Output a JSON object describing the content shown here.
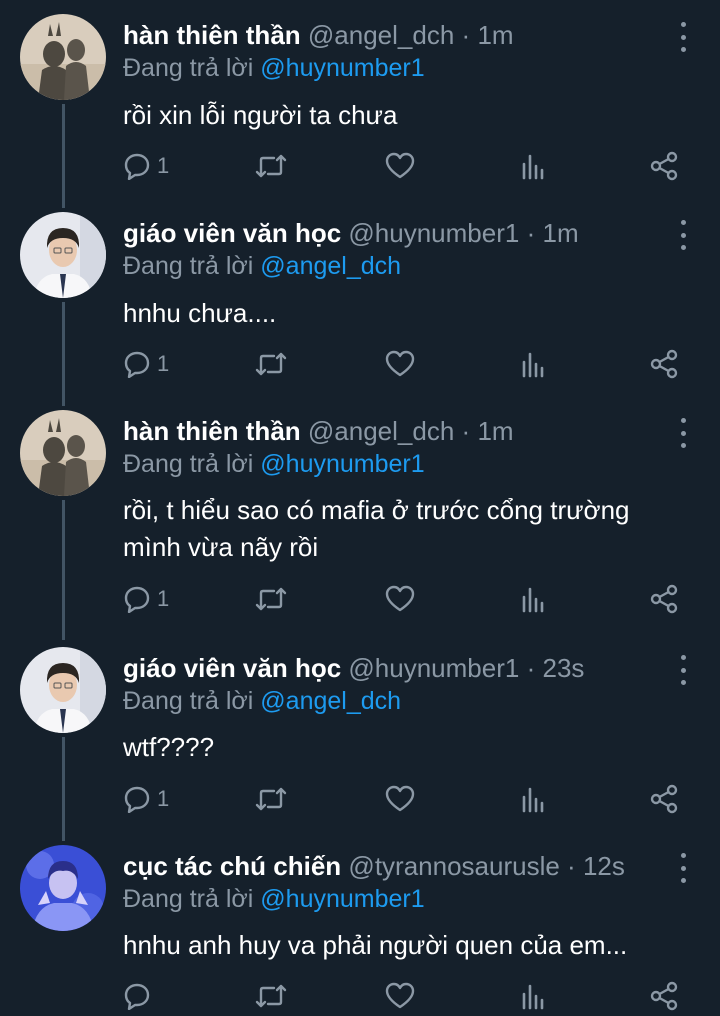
{
  "tweets": [
    {
      "name": "hàn thiên thần",
      "handle": "@angel_dch",
      "dot": "·",
      "time": "1m",
      "reply_prefix": "Đang trả lời",
      "reply_mention": "@huynumber1",
      "lines": [
        "rồi xin lỗi người ta chưa"
      ],
      "reply_count": "1",
      "avatar": "shadow-selfie-avatar"
    },
    {
      "name": "giáo viên văn học",
      "handle": "@huynumber1",
      "dot": "·",
      "time": "1m",
      "reply_prefix": "Đang trả lời",
      "reply_mention": "@angel_dch",
      "lines": [
        "hnhu chưa...."
      ],
      "reply_count": "1",
      "avatar": "student-portrait-avatar"
    },
    {
      "name": "hàn thiên thần",
      "handle": "@angel_dch",
      "dot": "·",
      "time": "1m",
      "reply_prefix": "Đang trả lời",
      "reply_mention": "@huynumber1",
      "lines": [
        "rồi, t hiểu sao có mafia ở trước cổng trường",
        "mình vừa nãy rồi"
      ],
      "reply_count": "1",
      "avatar": "shadow-selfie-avatar"
    },
    {
      "name": "giáo viên văn học",
      "handle": "@huynumber1",
      "dot": "·",
      "time": "23s",
      "reply_prefix": "Đang trả lời",
      "reply_mention": "@angel_dch",
      "lines": [
        "wtf????"
      ],
      "reply_count": "1",
      "avatar": "student-portrait-avatar"
    },
    {
      "name": "cục tác chú chiến",
      "handle": "@tyrannosaurusle",
      "dot": "·",
      "time": "12s",
      "reply_prefix": "Đang trả lời",
      "reply_mention": "@huynumber1",
      "lines": [
        "hnhu anh huy va phải người quen của em..."
      ],
      "reply_count": "",
      "avatar": "blue-filter-avatar"
    }
  ],
  "colors": {
    "background": "#15202b",
    "thread_line": "#425464",
    "secondary_text": "#8b98a5",
    "mention": "#1d9bf0"
  }
}
